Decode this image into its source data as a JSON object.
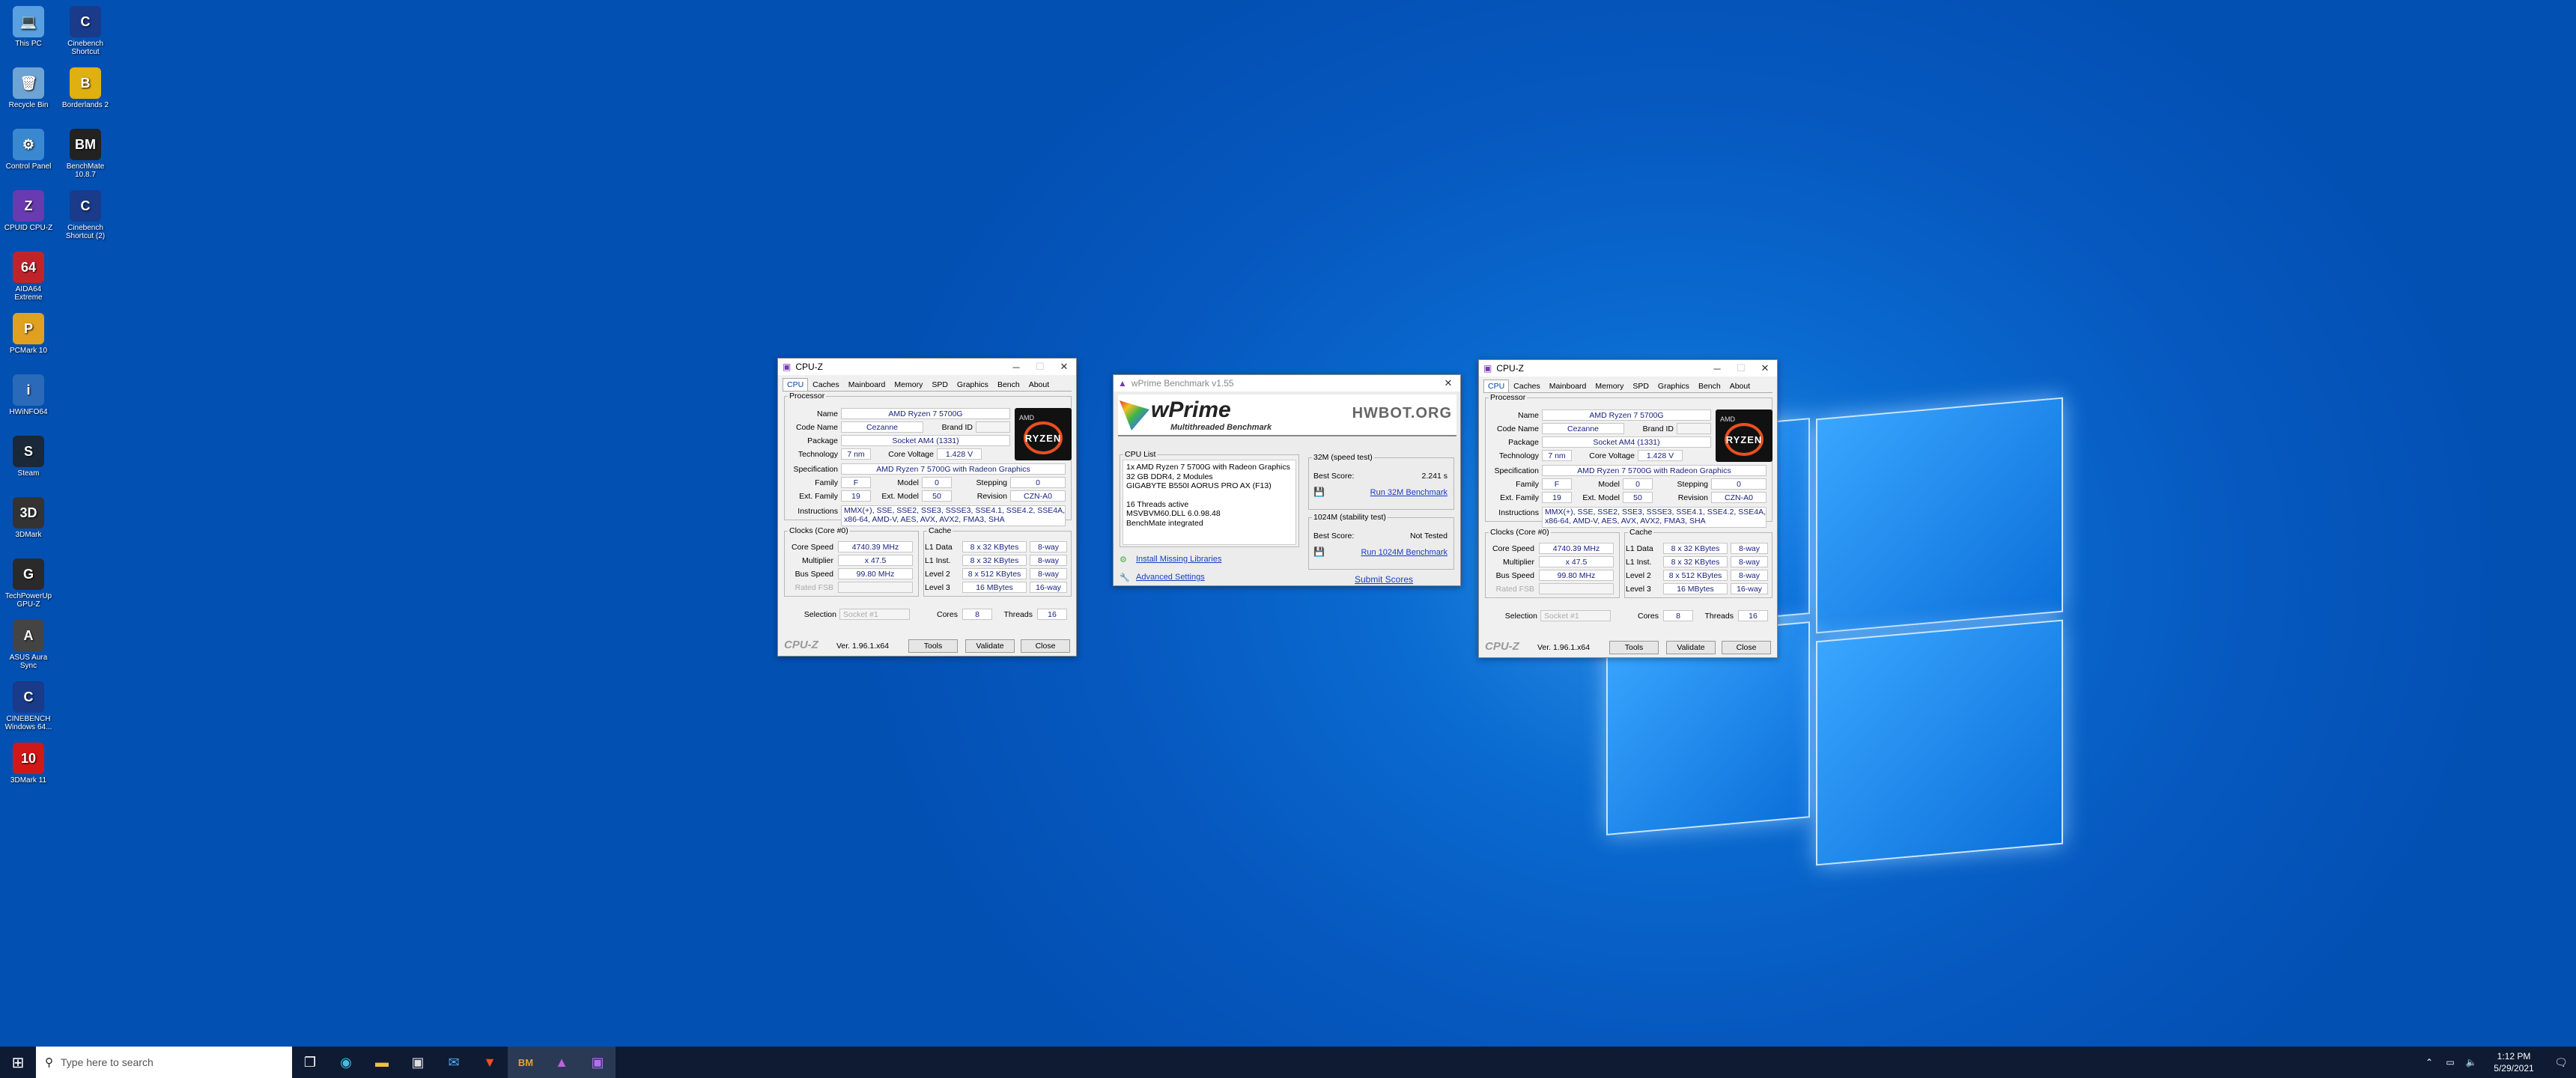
{
  "desktop_icons": [
    {
      "label": "This PC",
      "glyph": "💻",
      "color": "#5aa0e0"
    },
    {
      "label": "Recycle Bin",
      "glyph": "🗑",
      "color": "#6ea4d4"
    },
    {
      "label": "Control Panel",
      "glyph": "⚙",
      "color": "#3a88d0"
    },
    {
      "label": "CPUID CPU-Z",
      "glyph": "Z",
      "color": "#6a3ab0"
    },
    {
      "label": "AIDA64 Extreme",
      "glyph": "64",
      "color": "#c0242a"
    },
    {
      "label": "PCMark 10",
      "glyph": "P",
      "color": "#e0a020"
    },
    {
      "label": "HWiNFO64",
      "glyph": "i",
      "color": "#2a6ab8"
    },
    {
      "label": "Steam",
      "glyph": "S",
      "color": "#1b2838"
    },
    {
      "label": "3DMark",
      "glyph": "3D",
      "color": "#333"
    },
    {
      "label": "TechPowerUp GPU-Z",
      "glyph": "G",
      "color": "#2a2a2a"
    },
    {
      "label": "ASUS Aura Sync",
      "glyph": "A",
      "color": "#444"
    },
    {
      "label": "CINEBENCH Windows 64...",
      "glyph": "C",
      "color": "#1a3a8a"
    },
    {
      "label": "3DMark 11",
      "glyph": "10",
      "color": "#d01818"
    },
    {
      "label": "Cinebench Shortcut",
      "glyph": "C",
      "color": "#1a3a8a"
    },
    {
      "label": "Borderlands 2",
      "glyph": "B",
      "color": "#e0b010"
    },
    {
      "label": "BenchMate 10.8.7",
      "glyph": "BM",
      "color": "#222"
    },
    {
      "label": "Cinebench Shortcut (2)",
      "glyph": "C",
      "color": "#1a3a8a"
    }
  ],
  "cpuz_left": {
    "title": "CPU-Z",
    "tabs": [
      "CPU",
      "Caches",
      "Mainboard",
      "Memory",
      "SPD",
      "Graphics",
      "Bench",
      "About"
    ],
    "processor_group": "Processor",
    "name_label": "Name",
    "name": "AMD Ryzen 7 5700G",
    "codename_label": "Code Name",
    "codename": "Cezanne",
    "brandid_label": "Brand ID",
    "package_label": "Package",
    "package": "Socket AM4 (1331)",
    "technology_label": "Technology",
    "technology": "7 nm",
    "corevoltage_label": "Core Voltage",
    "corevoltage": "1.428 V",
    "spec_label": "Specification",
    "spec": "AMD Ryzen 7 5700G with Radeon Graphics",
    "family_label": "Family",
    "family": "F",
    "model_label": "Model",
    "model": "0",
    "stepping_label": "Stepping",
    "stepping": "0",
    "extfamily_label": "Ext. Family",
    "extfamily": "19",
    "extmodel_label": "Ext. Model",
    "extmodel": "50",
    "revision_label": "Revision",
    "revision": "CZN-A0",
    "instr_label": "Instructions",
    "instr": "MMX(+), SSE, SSE2, SSE3, SSSE3, SSE4.1, SSE4.2, SSE4A, x86-64, AMD-V, AES, AVX, AVX2, FMA3, SHA",
    "clocks_group": "Clocks (Core #0)",
    "corespeed_label": "Core Speed",
    "corespeed": "4740.39 MHz",
    "multiplier_label": "Multiplier",
    "multiplier": "x 47.5",
    "busspeed_label": "Bus Speed",
    "busspeed": "99.80 MHz",
    "ratedfsb_label": "Rated FSB",
    "cache_group": "Cache",
    "l1d_label": "L1 Data",
    "l1d": "8 x 32 KBytes",
    "l1d_way": "8-way",
    "l1i_label": "L1 Inst.",
    "l1i": "8 x 32 KBytes",
    "l1i_way": "8-way",
    "l2_label": "Level 2",
    "l2": "8 x 512 KBytes",
    "l2_way": "8-way",
    "l3_label": "Level 3",
    "l3": "16 MBytes",
    "l3_way": "16-way",
    "selection_label": "Selection",
    "selection": "Socket #1",
    "cores_label": "Cores",
    "cores": "8",
    "threads_label": "Threads",
    "threads": "16",
    "brand": "CPU-Z",
    "version": "Ver. 1.96.1.x64",
    "tools": "Tools",
    "validate": "Validate",
    "close": "Close",
    "logo_amd": "AMD",
    "logo_text": "RYZEN",
    "logo_num": "7"
  },
  "cpuz_right": {
    "title": "CPU-Z",
    "tabs": [
      "CPU",
      "Caches",
      "Mainboard",
      "Memory",
      "SPD",
      "Graphics",
      "Bench",
      "About"
    ],
    "processor_group": "Processor",
    "name_label": "Name",
    "name": "AMD Ryzen 7 5700G",
    "codename_label": "Code Name",
    "codename": "Cezanne",
    "brandid_label": "Brand ID",
    "package_label": "Package",
    "package": "Socket AM4 (1331)",
    "technology_label": "Technology",
    "technology": "7 nm",
    "corevoltage_label": "Core Voltage",
    "corevoltage": "1.428 V",
    "spec_label": "Specification",
    "spec": "AMD Ryzen 7 5700G with Radeon Graphics",
    "family_label": "Family",
    "family": "F",
    "model_label": "Model",
    "model": "0",
    "stepping_label": "Stepping",
    "stepping": "0",
    "extfamily_label": "Ext. Family",
    "extfamily": "19",
    "extmodel_label": "Ext. Model",
    "extmodel": "50",
    "revision_label": "Revision",
    "revision": "CZN-A0",
    "instr_label": "Instructions",
    "instr": "MMX(+), SSE, SSE2, SSE3, SSSE3, SSE4.1, SSE4.2, SSE4A, x86-64, AMD-V, AES, AVX, AVX2, FMA3, SHA",
    "clocks_group": "Clocks (Core #0)",
    "corespeed_label": "Core Speed",
    "corespeed": "4740.39 MHz",
    "multiplier_label": "Multiplier",
    "multiplier": "x 47.5",
    "busspeed_label": "Bus Speed",
    "busspeed": "99.80 MHz",
    "ratedfsb_label": "Rated FSB",
    "cache_group": "Cache",
    "l1d_label": "L1 Data",
    "l1d": "8 x 32 KBytes",
    "l1d_way": "8-way",
    "l1i_label": "L1 Inst.",
    "l1i": "8 x 32 KBytes",
    "l1i_way": "8-way",
    "l2_label": "Level 2",
    "l2": "8 x 512 KBytes",
    "l2_way": "8-way",
    "l3_label": "Level 3",
    "l3": "16 MBytes",
    "l3_way": "16-way",
    "selection_label": "Selection",
    "selection": "Socket #1",
    "cores_label": "Cores",
    "cores": "8",
    "threads_label": "Threads",
    "threads": "16",
    "brand": "CPU-Z",
    "version": "Ver. 1.96.1.x64",
    "tools": "Tools",
    "validate": "Validate",
    "close": "Close",
    "logo_amd": "AMD",
    "logo_text": "RYZEN",
    "logo_num": "7"
  },
  "wprime": {
    "title": "wPrime Benchmark v1.55",
    "logo": "wPrime",
    "subtitle": "Multithreaded Benchmark",
    "hwbot": "HWBOT.ORG",
    "cpulist_group": "CPU List",
    "cpu_lines": [
      "1x AMD Ryzen 7 5700G with Radeon Graphics",
      "32 GB DDR4, 2 Modules",
      "GIGABYTE B550I AORUS PRO AX (F13)",
      "",
      "16 Threads active",
      "MSVBVM60.DLL 6.0.98.48",
      "BenchMate integrated"
    ],
    "g32_group": "32M (speed test)",
    "best_score_label": "Best Score:",
    "g32_score": "2.241 s",
    "run32": "Run 32M Benchmark",
    "g1024_group": "1024M (stability test)",
    "g1024_score": "Not Tested",
    "run1024": "Run 1024M Benchmark",
    "install_libs": "Install Missing Libraries",
    "advanced": "Advanced Settings",
    "submit": "Submit Scores"
  },
  "taskbar": {
    "search_placeholder": "Type here to search",
    "time": "1:12 PM",
    "date": "5/29/2021"
  }
}
